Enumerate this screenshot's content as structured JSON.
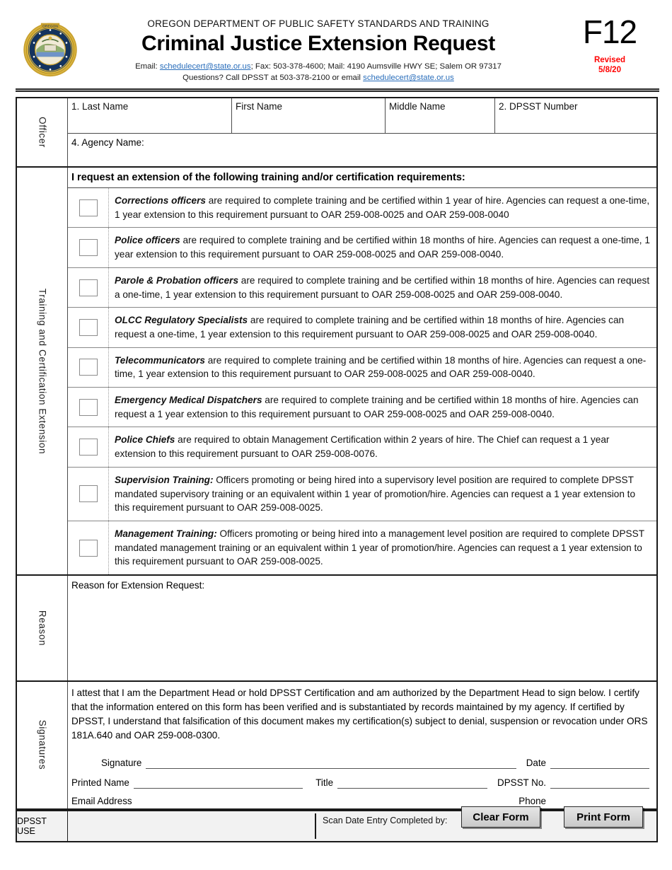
{
  "header": {
    "dept_line": "OREGON DEPARTMENT OF PUBLIC SAFETY STANDARDS AND TRAINING",
    "title": "Criminal Justice Extension Request",
    "contact_line1_prefix": "Email:  ",
    "contact_email": "schedulecert@state.or.us",
    "contact_line1_rest": ";  Fax:  503-378-4600;   Mail:  4190 Aumsville HWY SE; Salem OR 97317",
    "contact_line2_prefix": "Questions?  Call DPSST at 503-378-2100 or email ",
    "contact_email2": "schedulecert@state.or.us",
    "form_code": "F12",
    "revised_label": "Revised",
    "revised_date": "5/8/20",
    "revised_color": "#ff0000",
    "link_color": "#2a6ebb"
  },
  "officer": {
    "side_label": "Officer",
    "last_name": "1. Last Name",
    "first_name": "First Name",
    "middle_name": "Middle Name",
    "dpsst_number": "2. DPSST Number",
    "agency_name": "4. Agency Name:"
  },
  "training": {
    "side_label": "Training  and Certification Extension",
    "intro": "I request an extension of the following training and/or certification requirements:",
    "items": [
      {
        "lead": "Corrections officers",
        "text": " are required to complete training and be certified within 1 year of hire.  Agencies can request a one-time, 1 year extension to this requirement pursuant to OAR 259-008-0025 and OAR 259-008-0040",
        "checked": false
      },
      {
        "lead": "Police officers",
        "text": " are required to complete training and be certified within 18 months of hire.  Agencies can request a one-time, 1 year extension to this requirement pursuant to OAR 259-008-0025 and OAR 259-008-0040.",
        "checked": false
      },
      {
        "lead": "Parole & Probation officers",
        "text": " are required to complete training and be certified within 18 months of hire.  Agencies can request a one-time, 1 year extension to this requirement pursuant to OAR 259-008-0025 and OAR 259-008-0040.",
        "checked": false
      },
      {
        "lead": "OLCC Regulatory Specialists",
        "text": " are required to complete training and be certified within 18 months of hire.  Agencies can request a one-time, 1 year extension to this requirement pursuant to OAR 259-008-0025 and OAR 259-008-0040.",
        "checked": false
      },
      {
        "lead": "Telecommunicators",
        "text": " are required to complete training and be certified within 18 months of hire.  Agencies can request a one-time, 1 year extension to this requirement pursuant to OAR 259-008-0025 and OAR 259-008-0040.",
        "checked": false
      },
      {
        "lead": "Emergency Medical Dispatchers",
        "text": " are required to complete training and be certified within 18 months of hire.  Agencies can request a 1 year extension to this requirement pursuant to OAR 259-008-0025 and OAR 259-008-0040.",
        "checked": false
      },
      {
        "lead": "Police Chiefs",
        "text": " are required to obtain Management Certification within 2 years of hire.  The Chief can request a 1 year extension to this requirement pursuant to OAR 259-008-0076.",
        "checked": false
      },
      {
        "lead": "Supervision Training:",
        "text": "  Officers promoting or being hired into a supervisory level position are required to complete DPSST mandated supervisory training or an equivalent within 1 year of promotion/hire.  Agencies can request a 1 year extension to this requirement pursuant to OAR 259-008-0025.",
        "checked": false
      },
      {
        "lead": "Management Training:",
        "text": "   Officers promoting or being hired into a management level position are required to complete DPSST mandated management training or an equivalent within 1 year of promotion/hire.  Agencies can request a 1 year extension to this requirement pursuant to OAR 259-008-0025.",
        "checked": false
      }
    ]
  },
  "reason": {
    "side_label": "Reason",
    "label": "Reason for Extension Request:",
    "value": ""
  },
  "signatures": {
    "side_label": "Signatures",
    "attestation": "I attest that I am the Department Head or hold DPSST Certification and am authorized by the Department Head to sign below.  I certify that the information entered on this form has been verified and is substantiated by records maintained by my agency.  If certified by DPSST, I understand that falsification of this document makes my certification(s) subject to denial, suspension or revocation under ORS 181A.640 and OAR 259-008-0300.",
    "signature_label": "Signature",
    "date_label": "Date",
    "printed_name_label": "Printed Name",
    "title_label": "Title",
    "dpsst_no_label": "DPSST No.",
    "email_label": "Email Address",
    "phone_label": "Phone",
    "signature_value": "",
    "date_value": "",
    "printed_name_value": "",
    "title_value": "",
    "dpsst_no_value": "",
    "email_value": "",
    "phone_value": ""
  },
  "footer": {
    "dpsst_use_label": "DPSST USE",
    "field1_value": "",
    "field2_value": "",
    "obscured_text": "Scan Date Entry Completed by:",
    "clear_form_label": "Clear Form",
    "print_form_label": "Print Form"
  }
}
